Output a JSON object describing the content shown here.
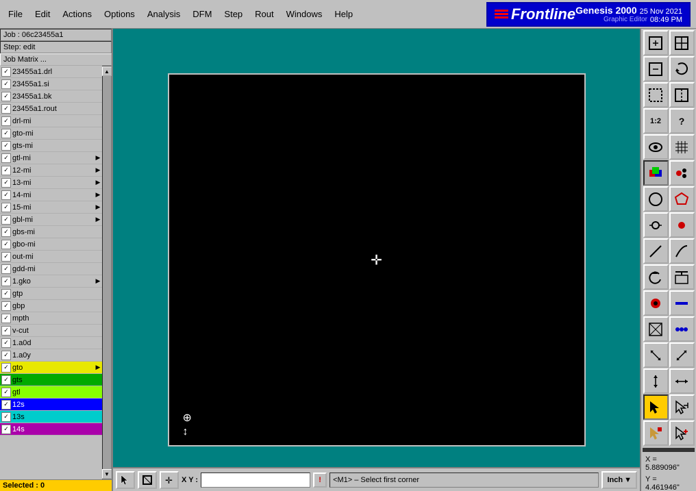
{
  "app": {
    "title": "Genesis 2000",
    "subtitle": "Graphic Editor",
    "date": "25 Nov 2021",
    "time": "08:49 PM"
  },
  "menu": {
    "items": [
      "File",
      "Edit",
      "Actions",
      "Options",
      "Analysis",
      "DFM",
      "Step",
      "Rout",
      "Windows",
      "Help"
    ]
  },
  "job_info": {
    "job_label": "Job : 06c23455a1",
    "step_label": "Step: edit",
    "matrix_label": "Job Matrix ..."
  },
  "layers": [
    {
      "name": "23455a1.drl",
      "checked": true,
      "arrow": false,
      "style": ""
    },
    {
      "name": "23455a1.si",
      "checked": true,
      "arrow": false,
      "style": ""
    },
    {
      "name": "23455a1.bk",
      "checked": true,
      "arrow": false,
      "style": ""
    },
    {
      "name": "23455a1.rout",
      "checked": true,
      "arrow": false,
      "style": ""
    },
    {
      "name": "drl-mi",
      "checked": true,
      "arrow": false,
      "style": ""
    },
    {
      "name": "gto-mi",
      "checked": true,
      "arrow": false,
      "style": ""
    },
    {
      "name": "gts-mi",
      "checked": true,
      "arrow": false,
      "style": ""
    },
    {
      "name": "gtl-mi",
      "checked": true,
      "arrow": true,
      "style": ""
    },
    {
      "name": "12-mi",
      "checked": true,
      "arrow": true,
      "style": ""
    },
    {
      "name": "13-mi",
      "checked": true,
      "arrow": true,
      "style": ""
    },
    {
      "name": "14-mi",
      "checked": true,
      "arrow": true,
      "style": ""
    },
    {
      "name": "15-mi",
      "checked": true,
      "arrow": true,
      "style": ""
    },
    {
      "name": "gbl-mi",
      "checked": true,
      "arrow": true,
      "style": ""
    },
    {
      "name": "gbs-mi",
      "checked": true,
      "arrow": false,
      "style": ""
    },
    {
      "name": "gbo-mi",
      "checked": true,
      "arrow": false,
      "style": ""
    },
    {
      "name": "out-mi",
      "checked": true,
      "arrow": false,
      "style": ""
    },
    {
      "name": "gdd-mi",
      "checked": true,
      "arrow": false,
      "style": ""
    },
    {
      "name": "1.gko",
      "checked": true,
      "arrow": true,
      "style": ""
    },
    {
      "name": "gtp",
      "checked": true,
      "arrow": false,
      "style": ""
    },
    {
      "name": "gbp",
      "checked": true,
      "arrow": false,
      "style": ""
    },
    {
      "name": "mpth",
      "checked": true,
      "arrow": false,
      "style": ""
    },
    {
      "name": "v-cut",
      "checked": true,
      "arrow": false,
      "style": ""
    },
    {
      "name": "1.a0d",
      "checked": true,
      "arrow": false,
      "style": ""
    },
    {
      "name": "1.a0y",
      "checked": true,
      "arrow": false,
      "style": ""
    },
    {
      "name": "gto",
      "checked": true,
      "arrow": true,
      "style": "yellow"
    },
    {
      "name": "gts",
      "checked": true,
      "arrow": false,
      "style": "green"
    },
    {
      "name": "gtl",
      "checked": true,
      "arrow": false,
      "style": "lime"
    },
    {
      "name": "12s",
      "checked": true,
      "arrow": false,
      "style": "blue"
    },
    {
      "name": "13s",
      "checked": true,
      "arrow": false,
      "style": "cyan"
    },
    {
      "name": "14s",
      "checked": true,
      "arrow": false,
      "style": "purple"
    }
  ],
  "status": {
    "selected_label": "Selected : 0"
  },
  "coordinates": {
    "x_label": "X = 5.889096\"",
    "y_label": "Y = 4.461946\""
  },
  "bottom_bar": {
    "xy_label": "X Y :",
    "message": "<M1> – Select first corner",
    "unit": "Inch"
  },
  "toolbar": {
    "rows": [
      [
        "⬜",
        "⬛",
        "🏠",
        "❓"
      ],
      [
        "⬛",
        "⬛",
        "1:2",
        "?"
      ],
      [
        "👁",
        "⊞",
        "⊠",
        "⊡"
      ],
      [
        "⬤",
        "⬤",
        "⬤",
        "⬤"
      ],
      [
        "⊹",
        "✕",
        "○",
        "•"
      ],
      [
        "↗",
        "↗",
        "↺",
        "⊞"
      ],
      [
        "⬤",
        "—",
        "⬜",
        "⊹"
      ],
      [
        "▲",
        "▲",
        "▲",
        "▲"
      ],
      [
        "▶",
        "▶",
        "▶",
        "▶"
      ]
    ]
  }
}
